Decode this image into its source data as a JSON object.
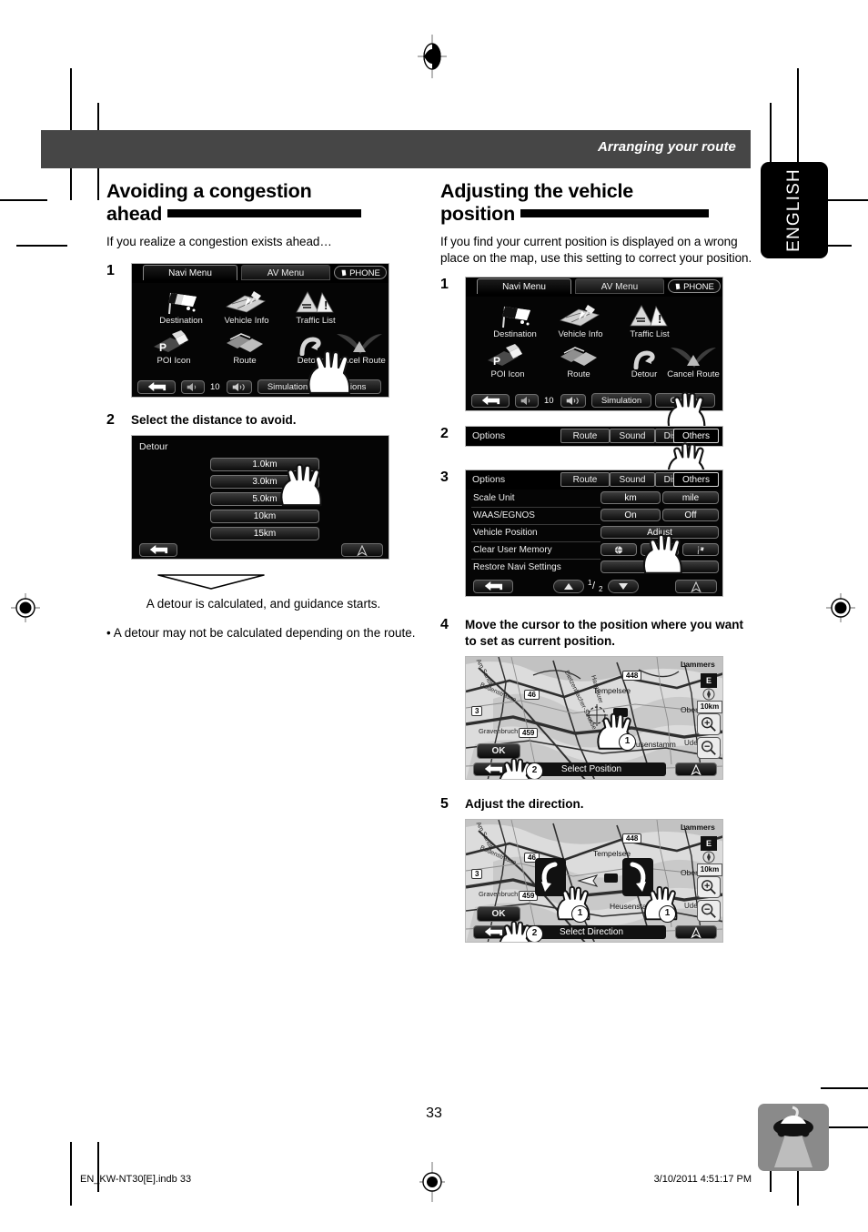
{
  "header": {
    "title": "Arranging your route"
  },
  "lang_tab": {
    "label": "ENGLISH"
  },
  "left_column": {
    "heading_line1": "Avoiding a congestion",
    "heading_line2": "ahead",
    "intro": "If you realize a congestion exists ahead…",
    "step1": {
      "num": "1"
    },
    "step2": {
      "num": "2",
      "text": "Select the distance to avoid."
    },
    "caption": "A detour is calculated, and guidance starts.",
    "bullet": "• A detour may not be calculated depending on the route."
  },
  "right_column": {
    "heading_line1": "Adjusting the vehicle",
    "heading_line2": "position",
    "intro": "If you find your current position is displayed on a wrong place on the map, use this setting to correct your position.",
    "step1": {
      "num": "1"
    },
    "step2": {
      "num": "2"
    },
    "step3": {
      "num": "3"
    },
    "step4": {
      "num": "4",
      "text": "Move the cursor to the position where you want to set as current position."
    },
    "step5": {
      "num": "5",
      "text": "Adjust the direction."
    }
  },
  "navi_menu": {
    "tabs": [
      {
        "label": "Navi Menu",
        "selected": true
      },
      {
        "label": "AV Menu",
        "selected": false
      }
    ],
    "phone_button": "PHONE",
    "icons": [
      {
        "label": "Destination",
        "icon": "checkered-flag-icon"
      },
      {
        "label": "Vehicle Info",
        "icon": "satellite-grid-icon"
      },
      {
        "label": "Traffic List",
        "icon": "traffic-warning-icon"
      },
      {
        "label": "POI Icon",
        "icon": "poi-parking-icon"
      },
      {
        "label": "Route",
        "icon": "route-layers-icon"
      },
      {
        "label": "Detour",
        "icon": "detour-arrow-icon"
      },
      {
        "label": "Cancel Route",
        "icon": "cancel-route-icon"
      }
    ],
    "toolbar": {
      "back": "back-arrow-icon",
      "vol_down": "volume-down-icon",
      "vol_value": "10",
      "vol_up": "volume-up-icon",
      "simulation": "Simulation",
      "options": "Options"
    }
  },
  "detour_screen": {
    "title": "Detour",
    "distances": [
      "1.0km",
      "3.0km",
      "5.0km",
      "10km",
      "15km"
    ],
    "back": "back-arrow-icon",
    "compass": "north-up-icon"
  },
  "options_bar": {
    "title": "Options",
    "tabs": [
      {
        "label": "Route",
        "selected": false
      },
      {
        "label": "Sound",
        "selected": false
      },
      {
        "label": "Display",
        "selected": false
      },
      {
        "label": "Others",
        "selected": true
      }
    ]
  },
  "options_screen": {
    "title": "Options",
    "tabs": [
      {
        "label": "Route",
        "selected": false
      },
      {
        "label": "Sound",
        "selected": false
      },
      {
        "label": "Display",
        "selected": false
      },
      {
        "label": "Others",
        "selected": true
      }
    ],
    "rows": [
      {
        "label": "Scale Unit",
        "buttons": [
          "km",
          "mile"
        ]
      },
      {
        "label": "WAAS/EGNOS",
        "buttons": [
          "On",
          "Off"
        ]
      },
      {
        "label": "Vehicle Position",
        "buttons": [
          "Adjust"
        ]
      },
      {
        "label": "Clear User Memory",
        "buttons": [
          "globe-icon",
          "star-icon",
          "flag-icon"
        ]
      },
      {
        "label": "Restore Navi Settings",
        "buttons": [
          "Restore"
        ]
      }
    ],
    "footer": {
      "back": "back-arrow-icon",
      "page_up": "up-arrow-icon",
      "page_indicator_num": "1",
      "page_indicator_den": "2",
      "page_down": "down-arrow-icon",
      "compass": "north-up-icon"
    }
  },
  "map_screen_position": {
    "status_label": "Select Position",
    "ok_button": "OK",
    "back": "back-arrow-icon",
    "compass": "north-up-icon",
    "direction_badge": "E",
    "scale_label": "10km",
    "zoom_in": "zoom-in-icon",
    "zoom_out": "zoom-out-icon",
    "callouts": [
      "1",
      "2"
    ],
    "labels": [
      "Lammers",
      "Tempelsee",
      "Obertsha",
      "Heusenstamm",
      "448",
      "46",
      "3",
      "459",
      "Ude",
      "ub",
      "Am Sandb",
      "Bodenstrasse",
      "Dietzenbacher-Strasse",
      "Hasslauer",
      "Gravenbruch",
      "urg"
    ]
  },
  "map_screen_direction": {
    "status_label": "Select Direction",
    "ok_button": "OK",
    "back": "back-arrow-icon",
    "compass": "north-up-icon",
    "direction_badge": "E",
    "scale_label": "10km",
    "zoom_in": "zoom-in-icon",
    "zoom_out": "zoom-out-icon",
    "rotate_left": "rotate-left-icon",
    "rotate_right": "rotate-right-icon",
    "callouts": [
      "1",
      "1",
      "2"
    ]
  },
  "footer": {
    "page_number": "33",
    "file_name": "EN_KW-NT30[E].indb   33",
    "timestamp": "3/10/2011   4:51:17 PM",
    "car_icon": "car-on-road-icon"
  }
}
